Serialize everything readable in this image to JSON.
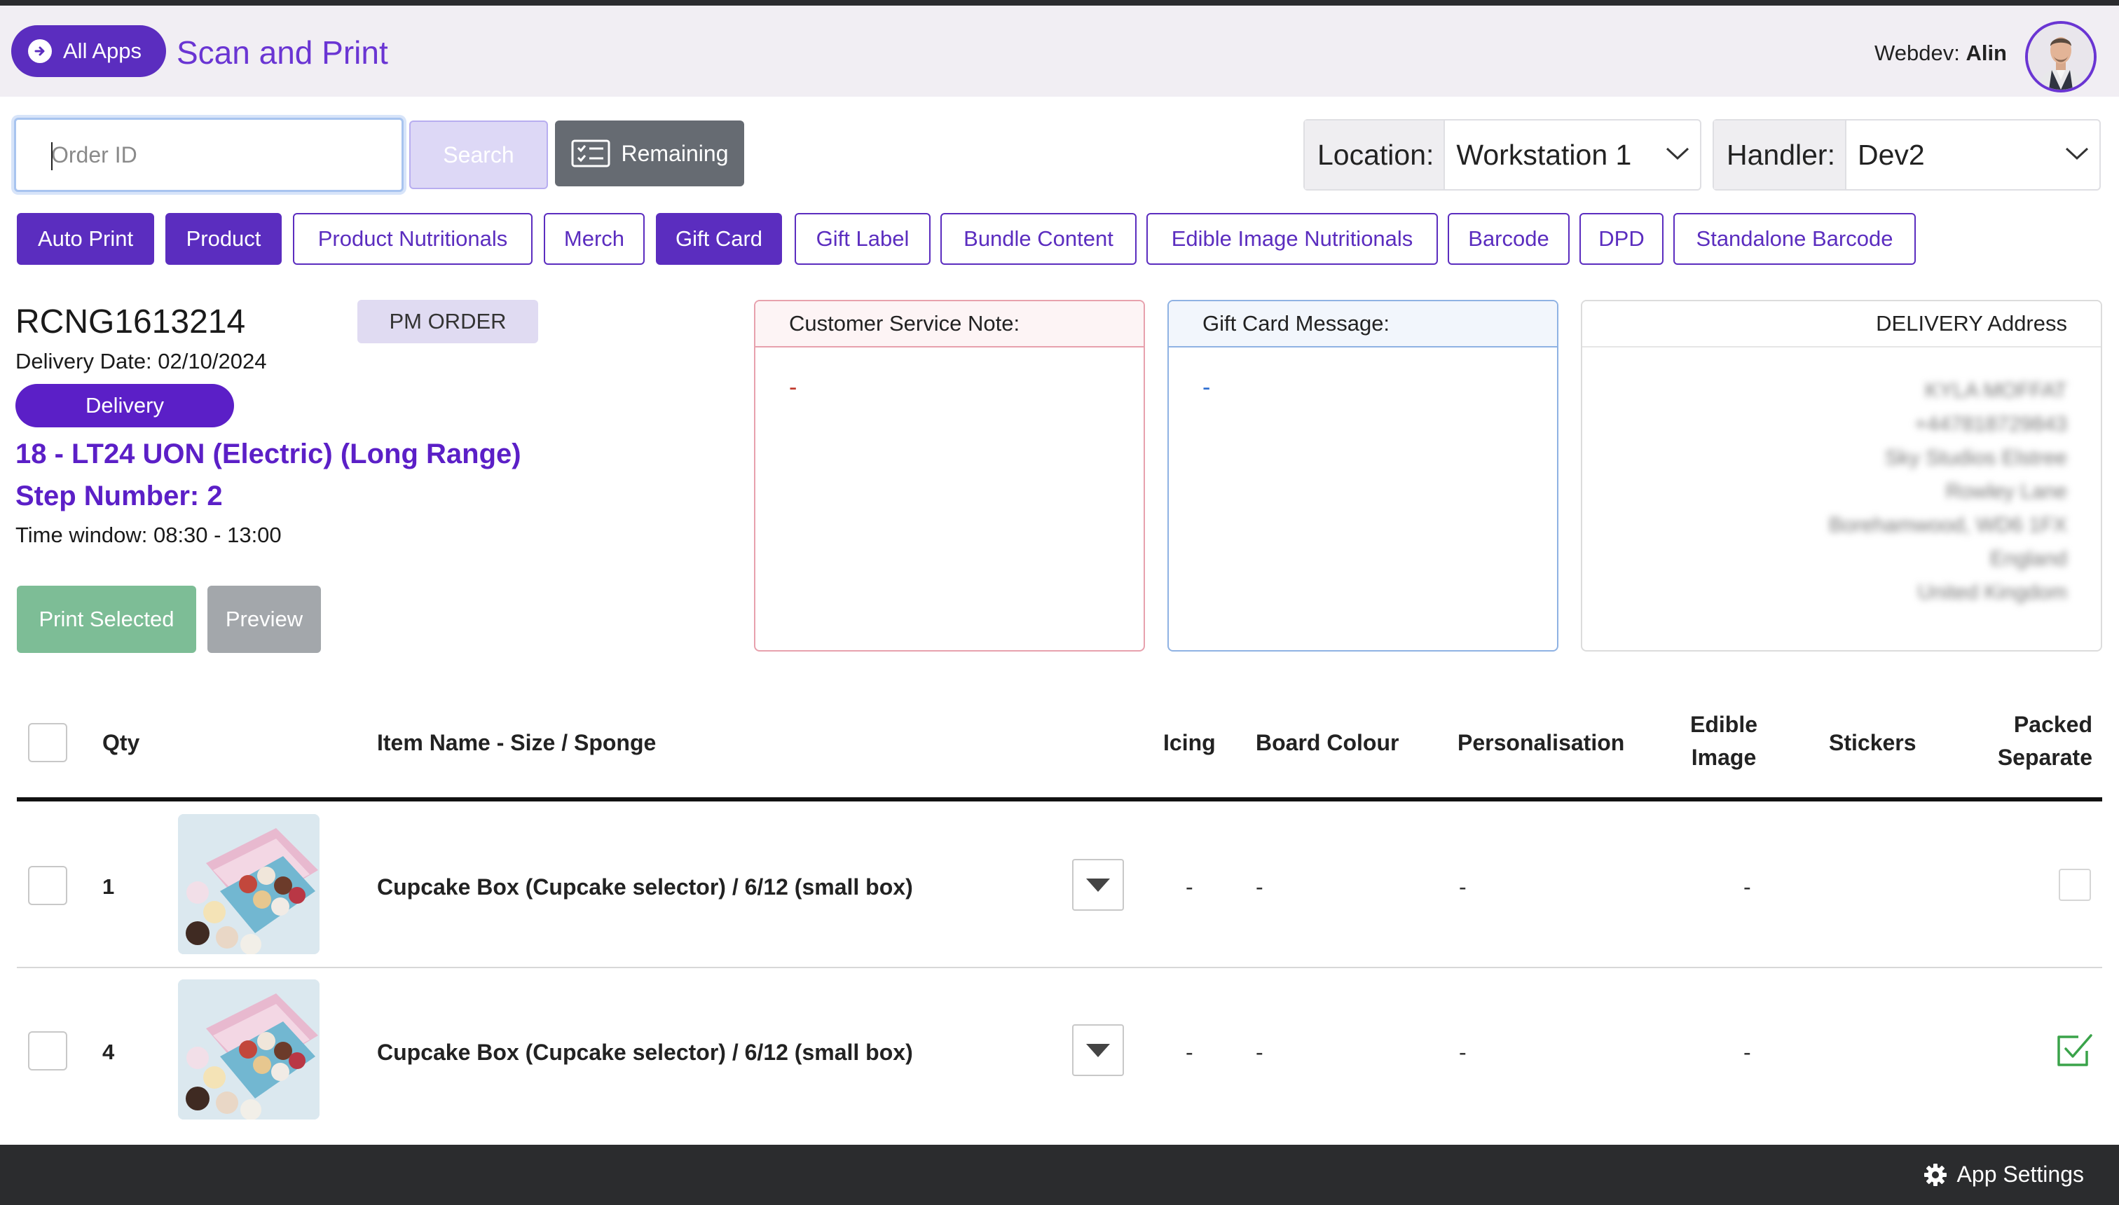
{
  "header": {
    "all_apps_label": "All Apps",
    "app_title": "Scan and Print",
    "user_prefix": "Webdev:",
    "user_name": "Alin"
  },
  "toolbar": {
    "order_placeholder": "Order ID",
    "search_label": "Search",
    "remaining_label": "Remaining",
    "location_label": "Location:",
    "location_value": "Workstation 1",
    "handler_label": "Handler:",
    "handler_value": "Dev2"
  },
  "print_types": [
    {
      "label": "Auto Print",
      "active": true
    },
    {
      "label": "Product",
      "active": true
    },
    {
      "label": "Product Nutritionals",
      "active": false
    },
    {
      "label": "Merch",
      "active": false
    },
    {
      "label": "Gift Card",
      "active": true
    },
    {
      "label": "Gift Label",
      "active": false
    },
    {
      "label": "Bundle Content",
      "active": false
    },
    {
      "label": "Edible Image Nutritionals",
      "active": false
    },
    {
      "label": "Barcode",
      "active": false
    },
    {
      "label": "DPD",
      "active": false
    },
    {
      "label": "Standalone Barcode",
      "active": false
    }
  ],
  "order": {
    "id": "RCNG1613214",
    "badge": "PM ORDER",
    "delivery_date": "Delivery Date: 02/10/2024",
    "delivery_type": "Delivery",
    "route": "18 - LT24 UON (Electric) (Long Range)",
    "step": "Step Number: 2",
    "time_window": "Time window: 08:30 - 13:00",
    "print_selected_label": "Print Selected",
    "preview_label": "Preview"
  },
  "notes": {
    "customer_service_title": "Customer Service Note:",
    "customer_service_value": "-",
    "gift_card_title": "Gift Card Message:",
    "gift_card_value": "-",
    "address_title": "DELIVERY Address",
    "address_lines": [
      "KYLA MOFFAT",
      "+447818729843",
      "Sky Studios Elstree",
      "Rowley Lane",
      "Borehamwood, WD6 1FX",
      "England",
      "United Kingdom"
    ]
  },
  "table": {
    "headers": {
      "qty": "Qty",
      "item": "Item Name - Size / Sponge",
      "icing": "Icing",
      "board": "Board Colour",
      "personalisation": "Personalisation",
      "edible_1": "Edible",
      "edible_2": "Image",
      "stickers": "Stickers",
      "packed_1": "Packed",
      "packed_2": "Separate"
    },
    "rows": [
      {
        "qty": "1",
        "name": "Cupcake Box (Cupcake selector) / 6/12 (small box)",
        "icing": "-",
        "board": "-",
        "personalisation": "-",
        "edible": "-",
        "packed_separate": false
      },
      {
        "qty": "4",
        "name": "Cupcake Box (Cupcake selector) / 6/12 (small box)",
        "icing": "-",
        "board": "-",
        "personalisation": "-",
        "edible": "-",
        "packed_separate": true
      }
    ]
  },
  "footer": {
    "settings_label": "App Settings"
  },
  "colors": {
    "brand": "#5b2dbf",
    "route_text": "#5b1fc7",
    "print_green": "#7dbd96",
    "check_green": "#3aa34a"
  },
  "icons": {
    "all_apps": "arrow-circle-icon",
    "remaining": "list-card-icon",
    "row_dropdown": "caret-down-icon",
    "settings": "gear-icon"
  }
}
